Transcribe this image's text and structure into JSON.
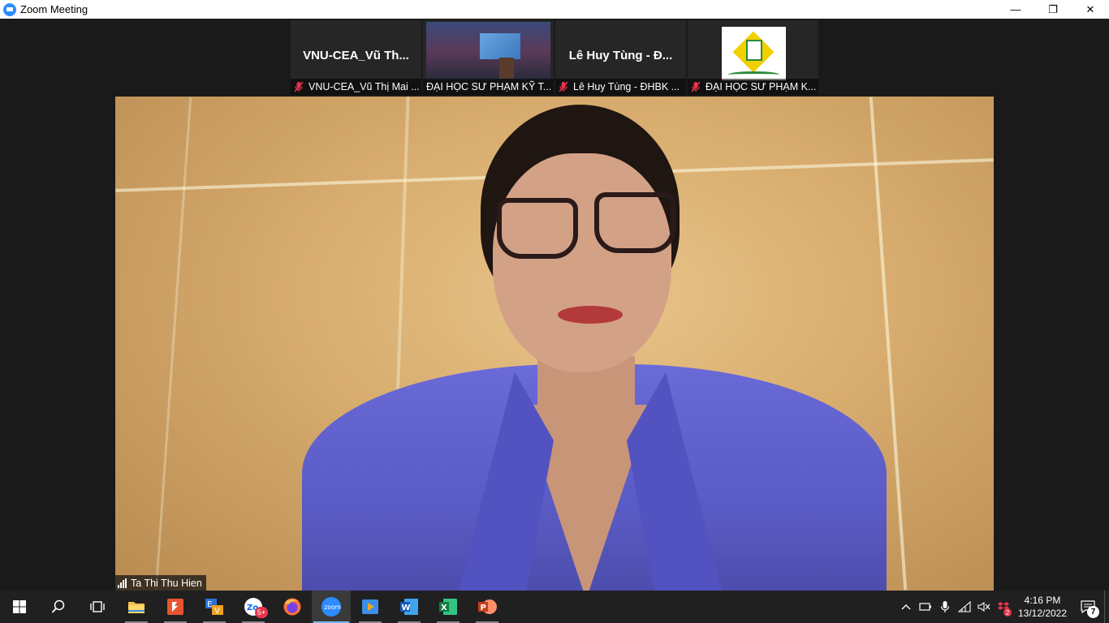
{
  "window": {
    "title": "Zoom Meeting",
    "minimize_label": "—",
    "restore_label": "❐",
    "close_label": "✕"
  },
  "gallery": {
    "participants": [
      {
        "display_name": "VNU-CEA_Vũ Th...",
        "label": "VNU-CEA_Vũ Thị Mai ...",
        "muted": true,
        "kind": "name"
      },
      {
        "label": "ĐẠI HỌC SƯ PHẠM KỸ T...",
        "muted": false,
        "kind": "video"
      },
      {
        "display_name": "Lê Huy Tùng - Đ...",
        "label": "Lê Huy Tùng - ĐHBK ...",
        "muted": true,
        "kind": "name"
      },
      {
        "label": "ĐẠI HỌC SƯ PHẠM K...",
        "muted": true,
        "kind": "logo"
      }
    ]
  },
  "speaker": {
    "name": "Ta Thi Thu Hien"
  },
  "taskbar": {
    "apps": [
      {
        "name": "start-button",
        "icon": "windows-icon"
      },
      {
        "name": "search-button",
        "icon": "search-icon"
      },
      {
        "name": "task-view-button",
        "icon": "task-view-icon"
      },
      {
        "name": "file-explorer-app",
        "icon": "folder-icon"
      },
      {
        "name": "foxit-reader-app",
        "icon": "pdf-icon"
      },
      {
        "name": "unikey-app",
        "icon": "keyboard-icon"
      },
      {
        "name": "zalo-app",
        "icon": "zalo-icon",
        "badge": "5+"
      },
      {
        "name": "firefox-app",
        "icon": "firefox-icon"
      },
      {
        "name": "zoom-app",
        "icon": "zoom-icon"
      },
      {
        "name": "media-player-app",
        "icon": "media-icon"
      },
      {
        "name": "word-app",
        "icon": "word-icon"
      },
      {
        "name": "excel-app",
        "icon": "excel-icon"
      },
      {
        "name": "powerpoint-app",
        "icon": "powerpoint-icon"
      }
    ],
    "zalo_badge": "5+",
    "zoom_label": "zoom",
    "clock_time": "4:16 PM",
    "clock_date": "13/12/2022",
    "notification_count": "7",
    "tray_badge": "2"
  },
  "colors": {
    "zoom_blue": "#2d8cff",
    "taskbar": "#202020",
    "muted_red": "#e8344e"
  }
}
